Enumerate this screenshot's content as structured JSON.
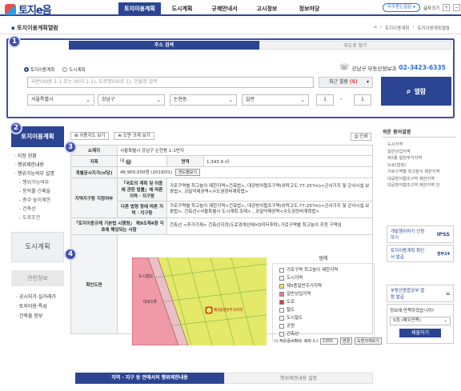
{
  "header": {
    "logo_text": "토지e음",
    "nav": [
      "토지이용계획",
      "도시계획",
      "규제안내서",
      "고시정보",
      "정보마당"
    ],
    "pill": "자주묻는질문 ▾",
    "font_size_label": "글자크기",
    "font_plus": "+",
    "font_minus": "−"
  },
  "breadcrumb": {
    "title": "토지이용계획열람",
    "items": [
      "⌂",
      "토지이용계획",
      "토지이용계획열람"
    ]
  },
  "badges": [
    "1",
    "2",
    "3",
    "4"
  ],
  "search": {
    "tabs": [
      "주소 검색",
      "지도로 찾기"
    ],
    "radio_1": "토지이용계획",
    "radio_2": "도시계획",
    "office": "강남구 부동산정보과",
    "phone": "02-3423-6335",
    "placeholder": "지번(00동 1-1 또는 00리 1-1), 도로명(00로 1), 건물명 입력",
    "recent_label": "최근 열람",
    "recent_count": "(5)",
    "sido": "서울특별시",
    "sigungu": "강남구",
    "dong": "논현동",
    "san": "일반",
    "bonbun": "1",
    "dash": "-",
    "bubun": "1",
    "search_button": "열람"
  },
  "sidebar": {
    "head": "토지이용계획",
    "items": [
      "지정 현황",
      "행위제한내용",
      "행위가능여부 설명"
    ],
    "subitems": [
      "행위가능여부",
      "용적률·건폐율",
      "층수·높이제한",
      "건축선",
      "도로조건"
    ],
    "city_button": "도시계획",
    "related_head": "관련정보",
    "related": [
      "공시지가·실거래가",
      "토지이용·특성",
      "건축물 정보"
    ]
  },
  "tools": {
    "map_view": "이용지도 보기",
    "map_3d": "도면 크게 보기",
    "print": "인쇄"
  },
  "info": {
    "addr_h": "소재지",
    "addr": "서울특별시 강남구 논현동 1-1번지",
    "jimok_h": "지목",
    "jimok": "대",
    "area_h": "면적",
    "area": "1,343.9 ㎡",
    "price_h": "개별공시지가(㎡당)",
    "price": "46,900,000원 (2019/01)",
    "price_btn": "연도별보기",
    "zone_h": "지역지구등 지정여부",
    "law1_h": "「국토의 계획 및 이용에 관한 법률」에 따른 지역 · 지구등",
    "law1": "가로구역별 최고높이 제한지역<건축법>, 대공방어협조구역(위탁고도:77-257m)<군사기지 및 군사시설 보호법>, 과밀억제권역<수도권정비계획법>",
    "law2_h": "다른 법령 등에 따른 지역 · 지구등",
    "law2": "가로구역별 최고높이 제한지역<건축법>, 대공방어협조구역(위탁고도:77-257m)<군사기지 및 군사시설 보호법>, 건축선<서울특별시 도시계획 조례> , 과밀억제권역<수도권정비계획법>",
    "reg_h": "「토지이용규제 기본법 시행령」 제9조제4항 각 호에 해당되는 사항",
    "reg": "건축선 <추가기재> 건축선지정(도로경계선에서3미터후퇴),가로구역별 최고높이 지정 구역임",
    "map_h": "확인도면"
  },
  "legend": {
    "title": "범례",
    "items": [
      {
        "label": "가로구역 최고높이 제한지역",
        "color": "#ffffff"
      },
      {
        "label": "도시지역",
        "color": "#f5f5f5"
      },
      {
        "label": "제3종일반주거지역",
        "color": "#f1e57a"
      },
      {
        "label": "일반상업지역",
        "color": "#e87a8e"
      },
      {
        "label": "도로",
        "color": "#e23a3a"
      },
      {
        "label": "철도",
        "color": "#ffffff"
      },
      {
        "label": "도시철도",
        "color": "#ffffff"
      },
      {
        "label": "공원",
        "color": "#ffffff"
      },
      {
        "label": "건축선",
        "color": "#ffffff"
      }
    ],
    "small_label": "작은글씨확대",
    "scale_label": "축척 1 /",
    "scale_value": "1200",
    "scale_change": "변경",
    "enlarge": "도면크게보기"
  },
  "map_labels": {
    "a": "도시철도",
    "b": "대로1류",
    "c": "제3종일반주거지역"
  },
  "bottom_tabs": [
    "지역 · 지구 등 안에서의 행위제한내용",
    "행위제한내용 설명"
  ],
  "right": {
    "title": "쉬운 용어설명",
    "terms": [
      "도시지역",
      "일반상업지역",
      "제3종 일반주거지역",
      "도로(법정)",
      "가로구역별 최고높이 제한지역",
      "대공방어협조구역 제한지역",
      "대공방어협조구역 제한지역 안"
    ],
    "ad1": "개발행위허가 신청하기",
    "ad1_brand": "IPSS",
    "ad2": "토지이용계획 확인서 발급",
    "ad2_brand": "정부24",
    "ad3": "부동산종합공부 열람 발급",
    "ad3_brand": "⌂",
    "survey_q": "정보에 만족하셨습니까?",
    "survey_opt": "5점 (매우만족)",
    "survey_btn": "제출하기"
  }
}
